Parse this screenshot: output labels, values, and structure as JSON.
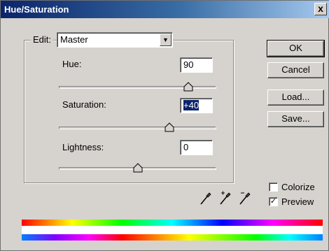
{
  "window": {
    "title": "Hue/Saturation",
    "close_glyph": "x"
  },
  "edit": {
    "label": "Edit:",
    "selected": "Master"
  },
  "hue": {
    "label": "Hue:",
    "value": "90",
    "slider_fraction": 0.82
  },
  "saturation": {
    "label": "Saturation:",
    "value": "+40",
    "slider_fraction": 0.7
  },
  "lightness": {
    "label": "Lightness:",
    "value": "0",
    "slider_fraction": 0.5
  },
  "buttons": {
    "ok": "OK",
    "cancel": "Cancel",
    "load": "Load...",
    "save": "Save..."
  },
  "options": {
    "colorize": {
      "label": "Colorize",
      "checked": false
    },
    "preview": {
      "label": "Preview",
      "checked": true
    }
  },
  "icons": [
    "eyedropper-icon",
    "eyedropper-plus-icon",
    "eyedropper-minus-icon"
  ],
  "colors": {
    "title_start": "#0a246a",
    "title_end": "#a6caf0",
    "selection": "#0a246a",
    "face": "#d6d3ce"
  }
}
